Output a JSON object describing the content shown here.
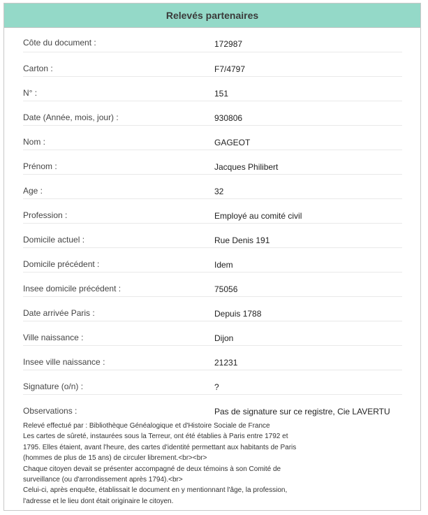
{
  "header": {
    "title": "Relevés partenaires"
  },
  "fields": [
    {
      "label": "Côte du document :",
      "value": "172987"
    },
    {
      "label": "Carton :",
      "value": "F7/4797"
    },
    {
      "label": "N° :",
      "value": "151"
    },
    {
      "label": "Date (Année, mois, jour) :",
      "value": "930806"
    },
    {
      "label": "Nom  :",
      "value": "GAGEOT"
    },
    {
      "label": "Prénom :",
      "value": "Jacques Philibert"
    },
    {
      "label": "Age :",
      "value": "32"
    },
    {
      "label": "Profession :",
      "value": "Employé au comité civil"
    },
    {
      "label": "Domicile actuel :",
      "value": "Rue Denis 191"
    },
    {
      "label": "Domicile précédent :",
      "value": "Idem"
    },
    {
      "label": "Insee domicile précédent :",
      "value": "75056"
    },
    {
      "label": "Date arrivée Paris :",
      "value": "Depuis 1788"
    },
    {
      "label": "Ville naissance :",
      "value": "Dijon"
    },
    {
      "label": "Insee ville naissance :",
      "value": "21231"
    },
    {
      "label": "Signature (o/n) :",
      "value": "?"
    },
    {
      "label": "Observations :",
      "value": "Pas de signature sur ce registre, Cie LAVERTU"
    }
  ],
  "notes": [
    "Relevé effectué par : Bibliothèque Généalogique et d'Histoire Sociale de France",
    "Les cartes de sûreté, instaurées sous la Terreur, ont été établies à Paris entre 1792 et",
    "1795. Elles étaient, avant l'heure, des cartes d'identité permettant aux habitants de Paris",
    "(hommes de plus de 15 ans) de circuler librement.<br><br>",
    "Chaque citoyen devait se présenter accompagné de deux témoins à son Comité de",
    "surveillance (ou d'arrondissement après 1794).<br>",
    "Celui-ci, après enquête, établissait le document en y mentionnant l'âge, la profession,",
    "l'adresse et le lieu dont était originaire le citoyen."
  ]
}
